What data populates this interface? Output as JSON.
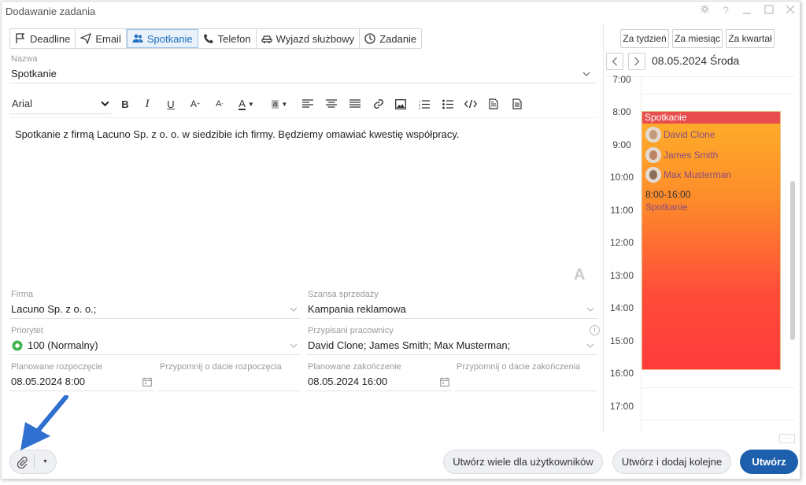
{
  "window": {
    "title": "Dodawanie zadania"
  },
  "tabs": [
    {
      "label": "Deadline",
      "icon": "flag-icon"
    },
    {
      "label": "Email",
      "icon": "send-icon"
    },
    {
      "label": "Spotkanie",
      "icon": "people-icon",
      "active": true
    },
    {
      "label": "Telefon",
      "icon": "phone-icon"
    },
    {
      "label": "Wyjazd służbowy",
      "icon": "car-icon"
    },
    {
      "label": "Zadanie",
      "icon": "clock-icon"
    }
  ],
  "name_field": {
    "label": "Nazwa",
    "value": "Spotkanie"
  },
  "toolbar": {
    "font": "Arial"
  },
  "editor": {
    "content": "Spotkanie z firmą Lacuno Sp. z o. o. w siedzibie ich firmy. Będziemy omawiać kwestię współpracy."
  },
  "fields": {
    "firma": {
      "label": "Firma",
      "value": "Lacuno Sp. z o. o.;"
    },
    "szansa": {
      "label": "Szansa sprzedaży",
      "value": "Kampania reklamowa"
    },
    "priorytet": {
      "label": "Priorytet",
      "value": "100 (Normalny)"
    },
    "przypisani": {
      "label": "Przypisani pracownicy",
      "value": "David Clone; James Smith; Max Musterman;"
    },
    "plan_start": {
      "label": "Planowane rozpoczęcie",
      "value": "08.05.2024 8:00"
    },
    "remind_start": {
      "label": "Przypomnij o dacie rozpoczęcia",
      "value": ""
    },
    "plan_end": {
      "label": "Planowane zakończenie",
      "value": "08.05.2024 16:00"
    },
    "remind_end": {
      "label": "Przypomnij o dacie zakończenia",
      "value": ""
    }
  },
  "calendar": {
    "range_buttons": [
      "Za tydzień",
      "Za miesiąc",
      "Za kwartał"
    ],
    "date_label": "08.05.2024 Środa",
    "hours": [
      "7:00",
      "8:00",
      "9:00",
      "10:00",
      "11:00",
      "12:00",
      "13:00",
      "14:00",
      "15:00",
      "16:00",
      "17:00"
    ],
    "event": {
      "title": "Spotkanie",
      "participants": [
        "David Clone",
        "James Smith",
        "Max Musterman"
      ],
      "time": "8:00-16:00",
      "type": "Spotkanie"
    }
  },
  "footer": {
    "btn_many": "Utwórz wiele dla użytkowników",
    "btn_create_next": "Utwórz i dodaj kolejne",
    "btn_create": "Utwórz"
  },
  "colors": {
    "accent": "#1e5fad",
    "event_header": "#e84e4e",
    "arrow": "#2f6fd0"
  }
}
